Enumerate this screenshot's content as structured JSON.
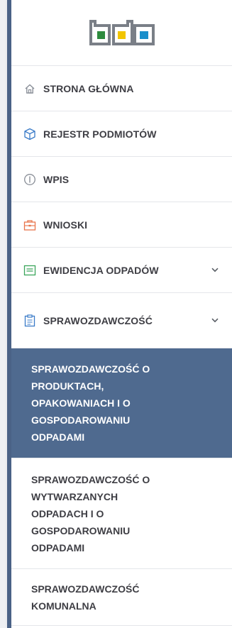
{
  "logo": {
    "alt": "bdo",
    "colors": [
      "#2e7d32",
      "#f2c500",
      "#1a8fcb"
    ]
  },
  "nav": [
    {
      "label": "STRONA GŁÓWNA",
      "icon": "home-icon"
    },
    {
      "label": "REJESTR PODMIOTÓW",
      "icon": "cube-icon"
    },
    {
      "label": "WPIS",
      "icon": "info-circle-icon"
    },
    {
      "label": "WNIOSKI",
      "icon": "briefcase-icon"
    },
    {
      "label": "EWIDENCJA ODPADÓW",
      "icon": "list-box-icon",
      "expandable": true
    },
    {
      "label": "SPRAWOZDAWCZOŚĆ",
      "icon": "clipboard-icon",
      "expandable": true
    }
  ],
  "submenu": [
    {
      "label": "SPRAWOZDAWCZOŚĆ O PRODUKTACH, OPAKOWANIACH I O GOSPODAROWANIU ODPADAMI",
      "active": true
    },
    {
      "label": "SPRAWOZDAWCZOŚĆ O WYTWARZANYCH ODPADACH I O GOSPODAROWANIU ODPADAMI",
      "active": false
    },
    {
      "label": "SPRAWOZDAWCZOŚĆ KOMUNALNA",
      "active": false
    }
  ],
  "colors": {
    "active_bg": "#4f6a8f",
    "text": "#3e3e44",
    "icon_gray": "#8a8f98",
    "icon_orange": "#e8744a",
    "icon_green": "#3aa55b",
    "icon_blue": "#3a7bc8"
  }
}
